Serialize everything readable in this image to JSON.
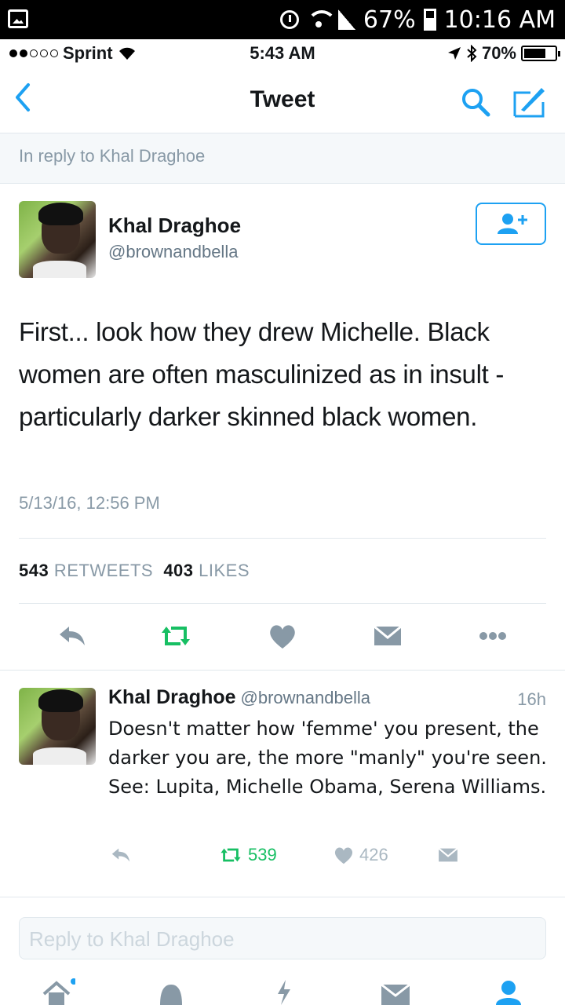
{
  "android_status": {
    "battery_percent": "67%",
    "time": "10:16 AM"
  },
  "ios_status": {
    "carrier": "Sprint",
    "time": "5:43 AM",
    "battery": "70%"
  },
  "nav": {
    "title": "Tweet",
    "back_icon": "‹"
  },
  "reply_banner": "In reply to Khal Draghoe",
  "tweet": {
    "name": "Khal Draghoe",
    "handle": "@brownandbella",
    "text": "First... look how they drew Michelle. Black women are often masculinized as in insult - particularly darker skinned black women.",
    "timestamp": "5/13/16, 12:56 PM",
    "retweets_count": "543",
    "retweets_label": "RETWEETS",
    "likes_count": "403",
    "likes_label": "LIKES"
  },
  "reply": {
    "name": "Khal Draghoe",
    "handle": "@brownandbella",
    "time": "16h",
    "text": "Doesn't matter how 'femme' you present, the darker you are, the more \"manly\" you're seen. See: Lupita, Michelle Obama, Serena Williams.",
    "retweets": "539",
    "likes": "426"
  },
  "reply_input": {
    "placeholder": "Reply to Khal Draghoe"
  },
  "colors": {
    "accent": "#1da1f2",
    "retweet": "#17bf63",
    "muted": "#8899a6",
    "icon": "#8899a6"
  },
  "tabs": [
    "home-icon",
    "notifications-icon",
    "moments-icon",
    "messages-icon",
    "me-icon"
  ]
}
